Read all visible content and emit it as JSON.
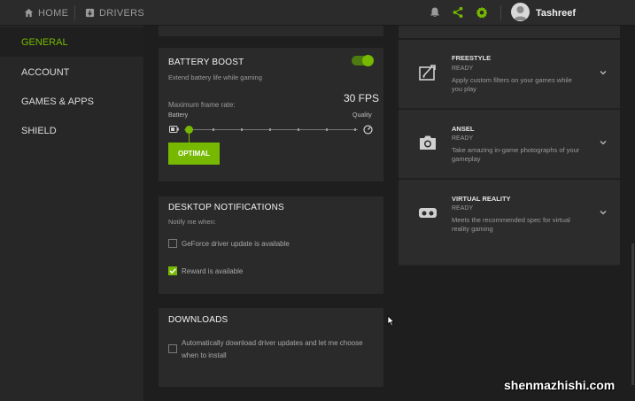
{
  "topnav": {
    "home": "HOME",
    "drivers": "DRIVERS",
    "username": "Tashreef"
  },
  "sidebar": {
    "items": [
      {
        "label": "GENERAL",
        "active": true
      },
      {
        "label": "ACCOUNT",
        "active": false
      },
      {
        "label": "GAMES & APPS",
        "active": false
      },
      {
        "label": "SHIELD",
        "active": false
      }
    ]
  },
  "battery": {
    "title": "BATTERY BOOST",
    "subtitle": "Extend battery life while gaming",
    "toggle_on": true,
    "max_frame_label": "Maximum frame rate:",
    "fps": "30 FPS",
    "left_label": "Battery",
    "right_label": "Quality",
    "button": "OPTIMAL"
  },
  "notifications": {
    "title": "DESKTOP NOTIFICATIONS",
    "subtitle": "Notify me when:",
    "opt1": "GeForce driver update is available",
    "opt1_checked": false,
    "opt2": "Reward is available",
    "opt2_checked": true
  },
  "downloads": {
    "title": "DOWNLOADS",
    "opt1_line1": "Automatically download driver updates and let me choose",
    "opt1_line2": "when to install",
    "opt1_checked": false
  },
  "features": [
    {
      "title": "FREESTYLE",
      "status": "READY",
      "desc_line1": "Apply custom filters on your games while",
      "desc_line2": "you play",
      "icon": "freestyle-icon"
    },
    {
      "title": "ANSEL",
      "status": "READY",
      "desc_line1": "Take amazing in-game photographs of your",
      "desc_line2": "gameplay",
      "icon": "camera-icon"
    },
    {
      "title": "VIRTUAL REALITY",
      "status": "READY",
      "desc_line1": "Meets the recommended spec for virtual",
      "desc_line2": "reality gaming",
      "icon": "vr-headset-icon"
    }
  ],
  "watermark": "shenmazhishi.com",
  "colors": {
    "accent": "#76b900",
    "background": "#1e1e1e",
    "card": "#2a2a2a",
    "sidebar": "#272727"
  }
}
